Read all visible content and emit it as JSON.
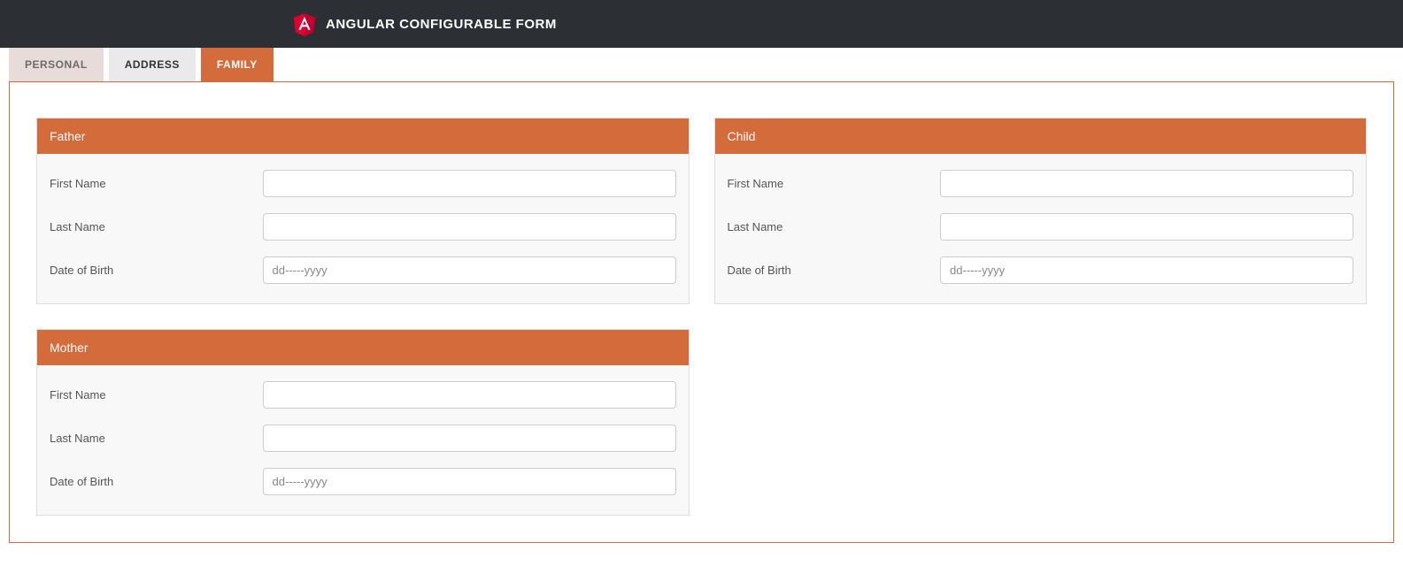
{
  "colors": {
    "headerBg": "#2c3034",
    "accent": "#d46b3a"
  },
  "header": {
    "title": "ANGULAR CONFIGURABLE FORM"
  },
  "tabs": [
    {
      "label": "PERSONAL",
      "active": false
    },
    {
      "label": "ADDRESS",
      "active": false
    },
    {
      "label": "FAMILY",
      "active": true
    }
  ],
  "cards": {
    "father": {
      "title": "Father",
      "fields": {
        "firstName": {
          "label": "First Name",
          "value": "",
          "placeholder": ""
        },
        "lastName": {
          "label": "Last Name",
          "value": "",
          "placeholder": ""
        },
        "dob": {
          "label": "Date of Birth",
          "value": "",
          "placeholder": "dd-----yyyy"
        }
      }
    },
    "child": {
      "title": "Child",
      "fields": {
        "firstName": {
          "label": "First Name",
          "value": "",
          "placeholder": ""
        },
        "lastName": {
          "label": "Last Name",
          "value": "",
          "placeholder": ""
        },
        "dob": {
          "label": "Date of Birth",
          "value": "",
          "placeholder": "dd-----yyyy"
        }
      }
    },
    "mother": {
      "title": "Mother",
      "fields": {
        "firstName": {
          "label": "First Name",
          "value": "",
          "placeholder": ""
        },
        "lastName": {
          "label": "Last Name",
          "value": "",
          "placeholder": ""
        },
        "dob": {
          "label": "Date of Birth",
          "value": "",
          "placeholder": "dd-----yyyy"
        }
      }
    }
  }
}
